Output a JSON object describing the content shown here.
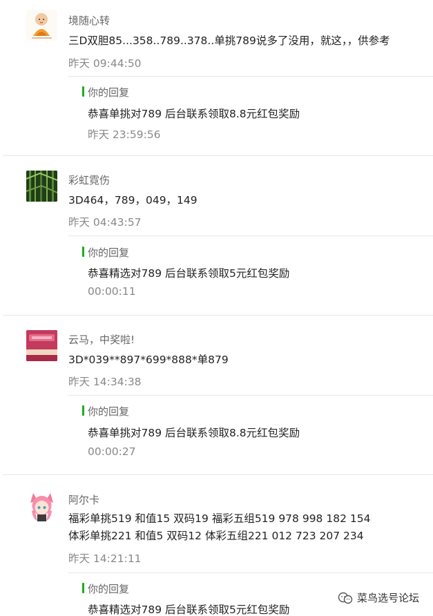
{
  "comments": [
    {
      "nickname": "境随心转",
      "content": "三D双胆85...358..789..378..单挑789说多了没用，就这，，供参考",
      "time": "昨天 09:44:50",
      "reply_label": "你的回复",
      "reply_text": "恭喜单挑对789 后台联系领取8.8元红包奖励",
      "reply_time": "昨天 23:59:56"
    },
    {
      "nickname": "彩虹霓伤",
      "content": "3D464，789，049，149",
      "time": "昨天 04:43:57",
      "reply_label": "你的回复",
      "reply_text": "恭喜精选对789 后台联系领取5元红包奖励",
      "reply_time": "00:00:11"
    },
    {
      "nickname": "云马，中奖啦!",
      "content": "3D*039**897*699*888*单879",
      "time": "昨天 14:34:38",
      "reply_label": "你的回复",
      "reply_text": "恭喜单挑对789 后台联系领取8.8元红包奖励",
      "reply_time": "00:00:27"
    },
    {
      "nickname": "阿尔卡",
      "content_lines": [
        "福彩单挑519 和值15 双码19 福彩五组519 978 998 182 154",
        "体彩单挑221 和值5 双码12 体彩五组221 012 723 207 234"
      ],
      "time": "昨天 14:21:11",
      "reply_label": "你的回复",
      "reply_text": "恭喜精选对789 后台联系领取5元红包奖励"
    }
  ],
  "watermark": {
    "text": "菜鸟选号论坛",
    "icon": "wechat-official-account-icon"
  },
  "colors": {
    "accent": "#1aad19",
    "nickname": "#666666",
    "time": "#888888",
    "divider": "#e6e6e6"
  }
}
